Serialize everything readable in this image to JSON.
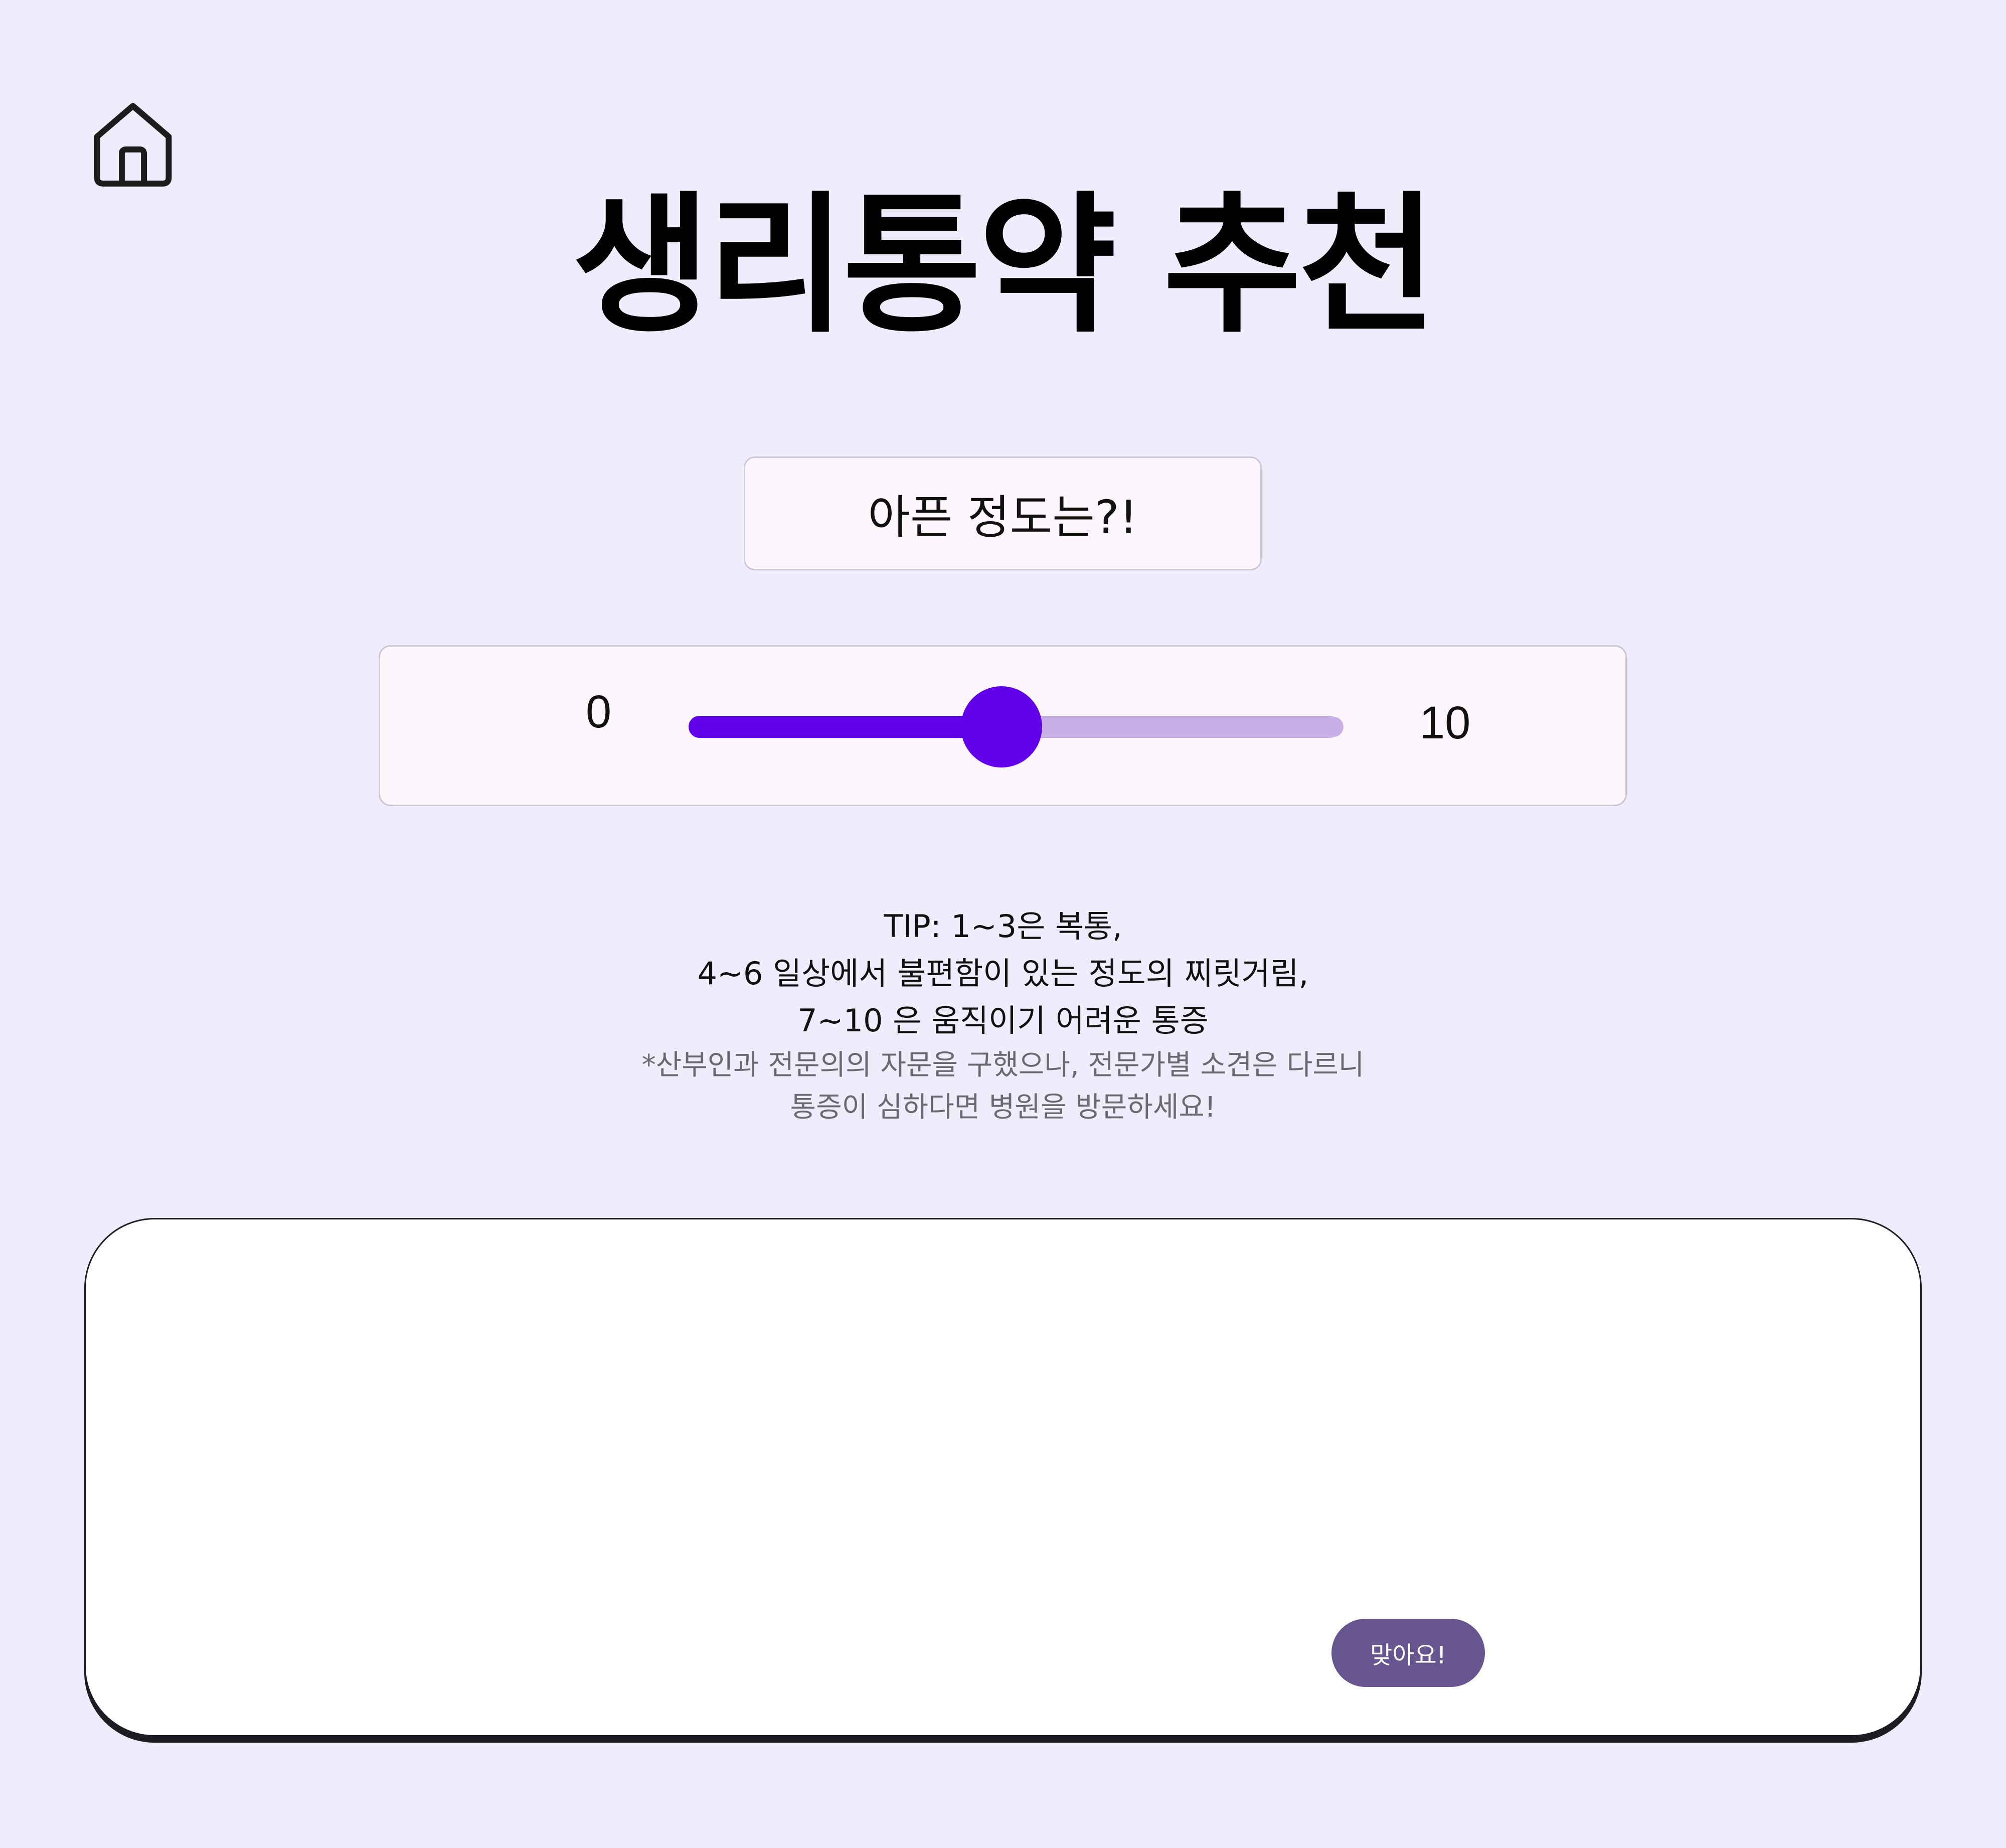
{
  "nav": {
    "home_icon": "home-icon"
  },
  "header": {
    "title": "생리통약 추천"
  },
  "question": {
    "label": "아픈 정도는?!"
  },
  "slider": {
    "min_label": "0",
    "max_label": "10",
    "min": 0,
    "max": 10,
    "value": 4.8,
    "accent_color": "#6200ea",
    "track_color": "#c6b0e6"
  },
  "tip": {
    "lines": [
      "TIP: 1~3은 복통,",
      "4~6 일상에서 불편함이 있는 정도의 찌릿거림,",
      "7~10 은 움직이기 어려운 통증"
    ],
    "notes": [
      "*산부인과 전문의의 자문을 구했으나, 전문가별 소견은 다르니",
      "통증이 심하다면 병원을 방문하세요!"
    ]
  },
  "result": {
    "confirm_label": "맞아요!",
    "button_color": "#66558e"
  },
  "colors": {
    "background": "#efedfb",
    "card_background": "#fdf7fd"
  }
}
